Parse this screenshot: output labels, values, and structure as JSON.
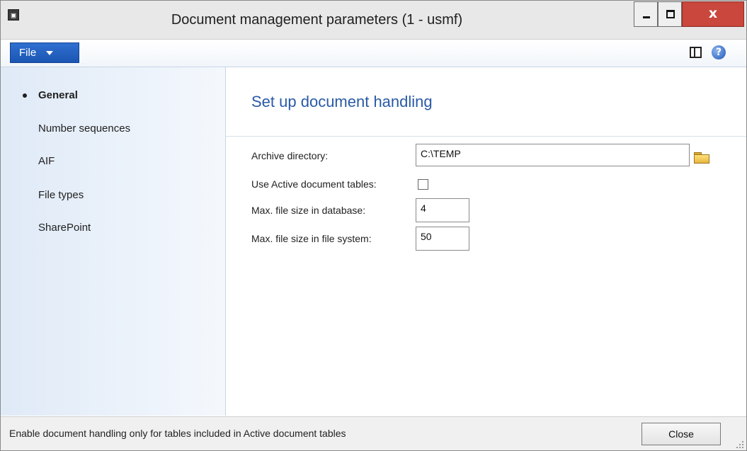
{
  "window": {
    "title": "Document management parameters (1 - usmf)",
    "close_glyph": "x"
  },
  "toolbar": {
    "file_label": "File",
    "help_glyph": "?"
  },
  "nav": {
    "items": [
      {
        "label": "General",
        "active": true
      },
      {
        "label": "Number sequences",
        "active": false
      },
      {
        "label": "AIF",
        "active": false
      },
      {
        "label": "File types",
        "active": false
      },
      {
        "label": "SharePoint",
        "active": false
      }
    ]
  },
  "content": {
    "heading": "Set up document handling",
    "archive_directory": {
      "label": "Archive directory:",
      "value": "C:\\TEMP"
    },
    "use_active_tables": {
      "label": "Use Active document tables:",
      "checked": false
    },
    "max_size_db": {
      "label": "Max. file size in database:",
      "value": "4"
    },
    "max_size_fs": {
      "label": "Max. file size in file system:",
      "value": "50"
    }
  },
  "status": {
    "text": "Enable document handling only for tables included in Active document tables",
    "close_label": "Close"
  },
  "icons": {
    "app": "app-icon",
    "minimize": "minimize-icon",
    "maximize": "maximize-icon",
    "close": "close-icon",
    "layout": "layout-icon",
    "help": "help-icon",
    "folder": "folder-icon",
    "caret": "chevron-down-icon"
  },
  "colors": {
    "file_button": "#1b56b3",
    "heading": "#2a5aa6",
    "close_button": "#c9473c",
    "nav_background": "#dfeaf7"
  }
}
